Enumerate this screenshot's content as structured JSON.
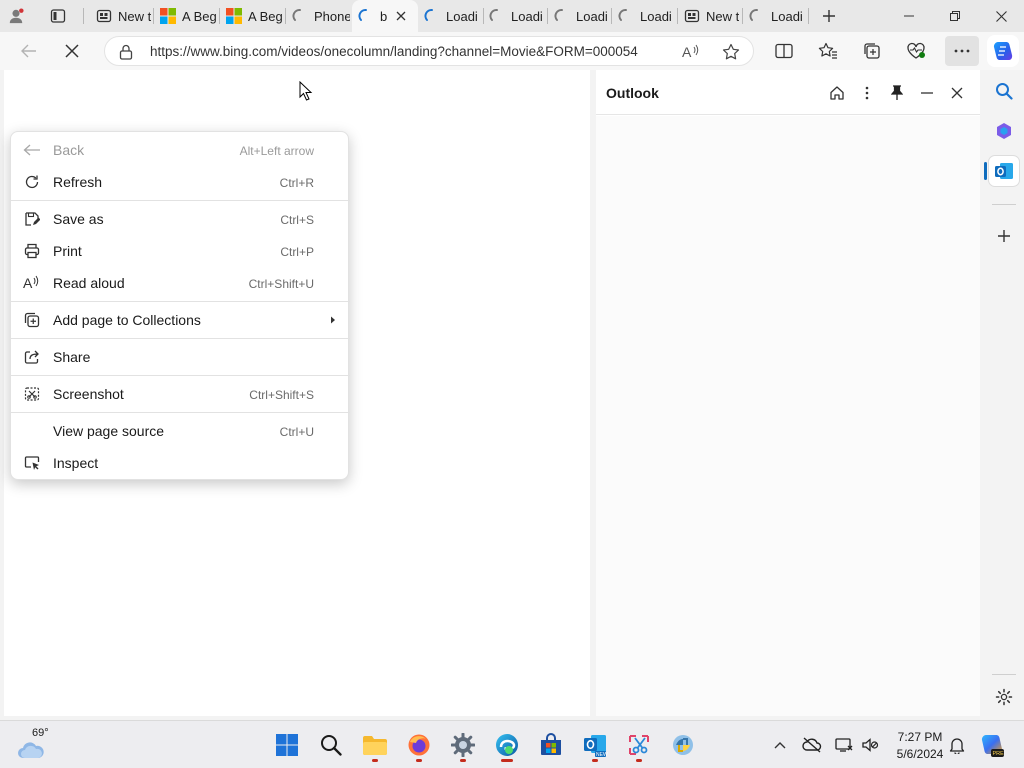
{
  "tabs": [
    {
      "title": "",
      "icon": "profile-icon"
    },
    {
      "title": "",
      "icon": "tab-actions-icon"
    },
    {
      "title": "New t",
      "icon": "new-tab-page-icon"
    },
    {
      "title": "A Beg",
      "icon": "microsoft-logo-icon"
    },
    {
      "title": "A Beg",
      "icon": "microsoft-logo-icon"
    },
    {
      "title": "Phone",
      "icon": "loading-spinner-icon"
    },
    {
      "title": "b",
      "icon": "loading-spinner-icon",
      "active": true
    },
    {
      "title": "Loadi",
      "icon": "loading-spinner-icon"
    },
    {
      "title": "Loadi",
      "icon": "loading-spinner-icon"
    },
    {
      "title": "Loadi",
      "icon": "loading-spinner-icon"
    },
    {
      "title": "Loadi",
      "icon": "loading-spinner-icon"
    },
    {
      "title": "New t",
      "icon": "new-tab-page-icon"
    },
    {
      "title": "Loadi",
      "icon": "loading-spinner-icon"
    }
  ],
  "address_bar": {
    "url": "https://www.bing.com/videos/onecolumn/landing?channel=Movie&FORM=000054"
  },
  "context_menu": {
    "items": [
      {
        "label": "Back",
        "shortcut": "Alt+Left arrow",
        "icon": "back-arrow-icon",
        "disabled": true
      },
      {
        "label": "Refresh",
        "shortcut": "Ctrl+R",
        "icon": "refresh-icon"
      },
      {
        "label": "Save as",
        "shortcut": "Ctrl+S",
        "icon": "save-as-icon"
      },
      {
        "label": "Print",
        "shortcut": "Ctrl+P",
        "icon": "print-icon"
      },
      {
        "label": "Read aloud",
        "shortcut": "Ctrl+Shift+U",
        "icon": "read-aloud-icon"
      },
      {
        "label": "Add page to Collections",
        "shortcut": "",
        "icon": "collections-icon",
        "submenu": true
      },
      {
        "label": "Share",
        "shortcut": "",
        "icon": "share-icon"
      },
      {
        "label": "Screenshot",
        "shortcut": "Ctrl+Shift+S",
        "icon": "screenshot-icon"
      },
      {
        "label": "View page source",
        "shortcut": "Ctrl+U",
        "icon": ""
      },
      {
        "label": "Inspect",
        "shortcut": "",
        "icon": "inspect-icon"
      }
    ]
  },
  "side_panel": {
    "title": "Outlook"
  },
  "taskbar": {
    "weather_temp": "69°",
    "clock_time": "7:27 PM",
    "clock_date": "5/6/2024",
    "apps": [
      "start",
      "search",
      "file-explorer",
      "firefox",
      "settings",
      "edge",
      "microsoft-store",
      "outlook-new",
      "snipping-tool",
      "python-app"
    ]
  },
  "colors": {
    "accent": "#0f6cbd",
    "edge_blue": "#1b74d1",
    "taskbar_indicator": "#c42b1c",
    "copilot": "#2b7fe8"
  }
}
